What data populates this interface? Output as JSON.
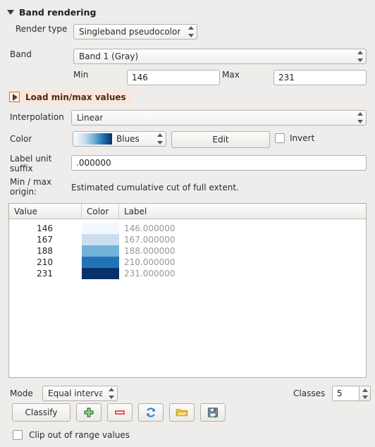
{
  "panel": {
    "group_title": "Band rendering",
    "collapse_icon": "triangle-down-icon"
  },
  "render_type": {
    "label": "Render type",
    "value": "Singleband pseudocolor"
  },
  "band": {
    "label": "Band",
    "value": "Band 1 (Gray)"
  },
  "minmax": {
    "min_label": "Min",
    "min_value": "146",
    "max_label": "Max",
    "max_value": "231"
  },
  "load_minmax": {
    "title": "Load min/max values",
    "expand_icon": "triangle-right-icon"
  },
  "interpolation": {
    "label": "Interpolation",
    "value": "Linear"
  },
  "color": {
    "label": "Color",
    "ramp_name": "Blues",
    "ramp_icon": "color-ramp-preview",
    "edit_label": "Edit",
    "invert_label": "Invert",
    "invert_checked": false
  },
  "label_unit_suffix": {
    "label": "Label unit suffix",
    "label_line1": "Label unit",
    "label_line2": "suffix",
    "value": ".000000"
  },
  "minmax_origin": {
    "label_line1": "Min / max",
    "label_line2": "origin:",
    "value": "Estimated cumulative cut of full extent."
  },
  "table": {
    "columns": [
      "Value",
      "Color",
      "Label"
    ],
    "rows": [
      {
        "value": "146",
        "color": "#f3f8fe",
        "label": "146.000000"
      },
      {
        "value": "167",
        "color": "#cadef0",
        "label": "167.000000"
      },
      {
        "value": "188",
        "color": "#73b2d9",
        "label": "188.000000"
      },
      {
        "value": "210",
        "color": "#2272b6",
        "label": "210.000000"
      },
      {
        "value": "231",
        "color": "#09306b",
        "label": "231.000000"
      }
    ]
  },
  "mode": {
    "label": "Mode",
    "value": "Equal interval"
  },
  "classes": {
    "label": "Classes",
    "value": "5"
  },
  "actions": {
    "classify_label": "Classify",
    "add_icon": "plus-icon",
    "remove_icon": "minus-icon",
    "reload_icon": "refresh-icon",
    "open_icon": "folder-open-icon",
    "save_icon": "floppy-save-icon"
  },
  "clip": {
    "label": "Clip out of range values",
    "checked": false
  },
  "colors": {
    "background": "#efedeb",
    "accent_orange": "#e06c2e",
    "ramp_start": "#f7fbff",
    "ramp_end": "#08306b"
  }
}
